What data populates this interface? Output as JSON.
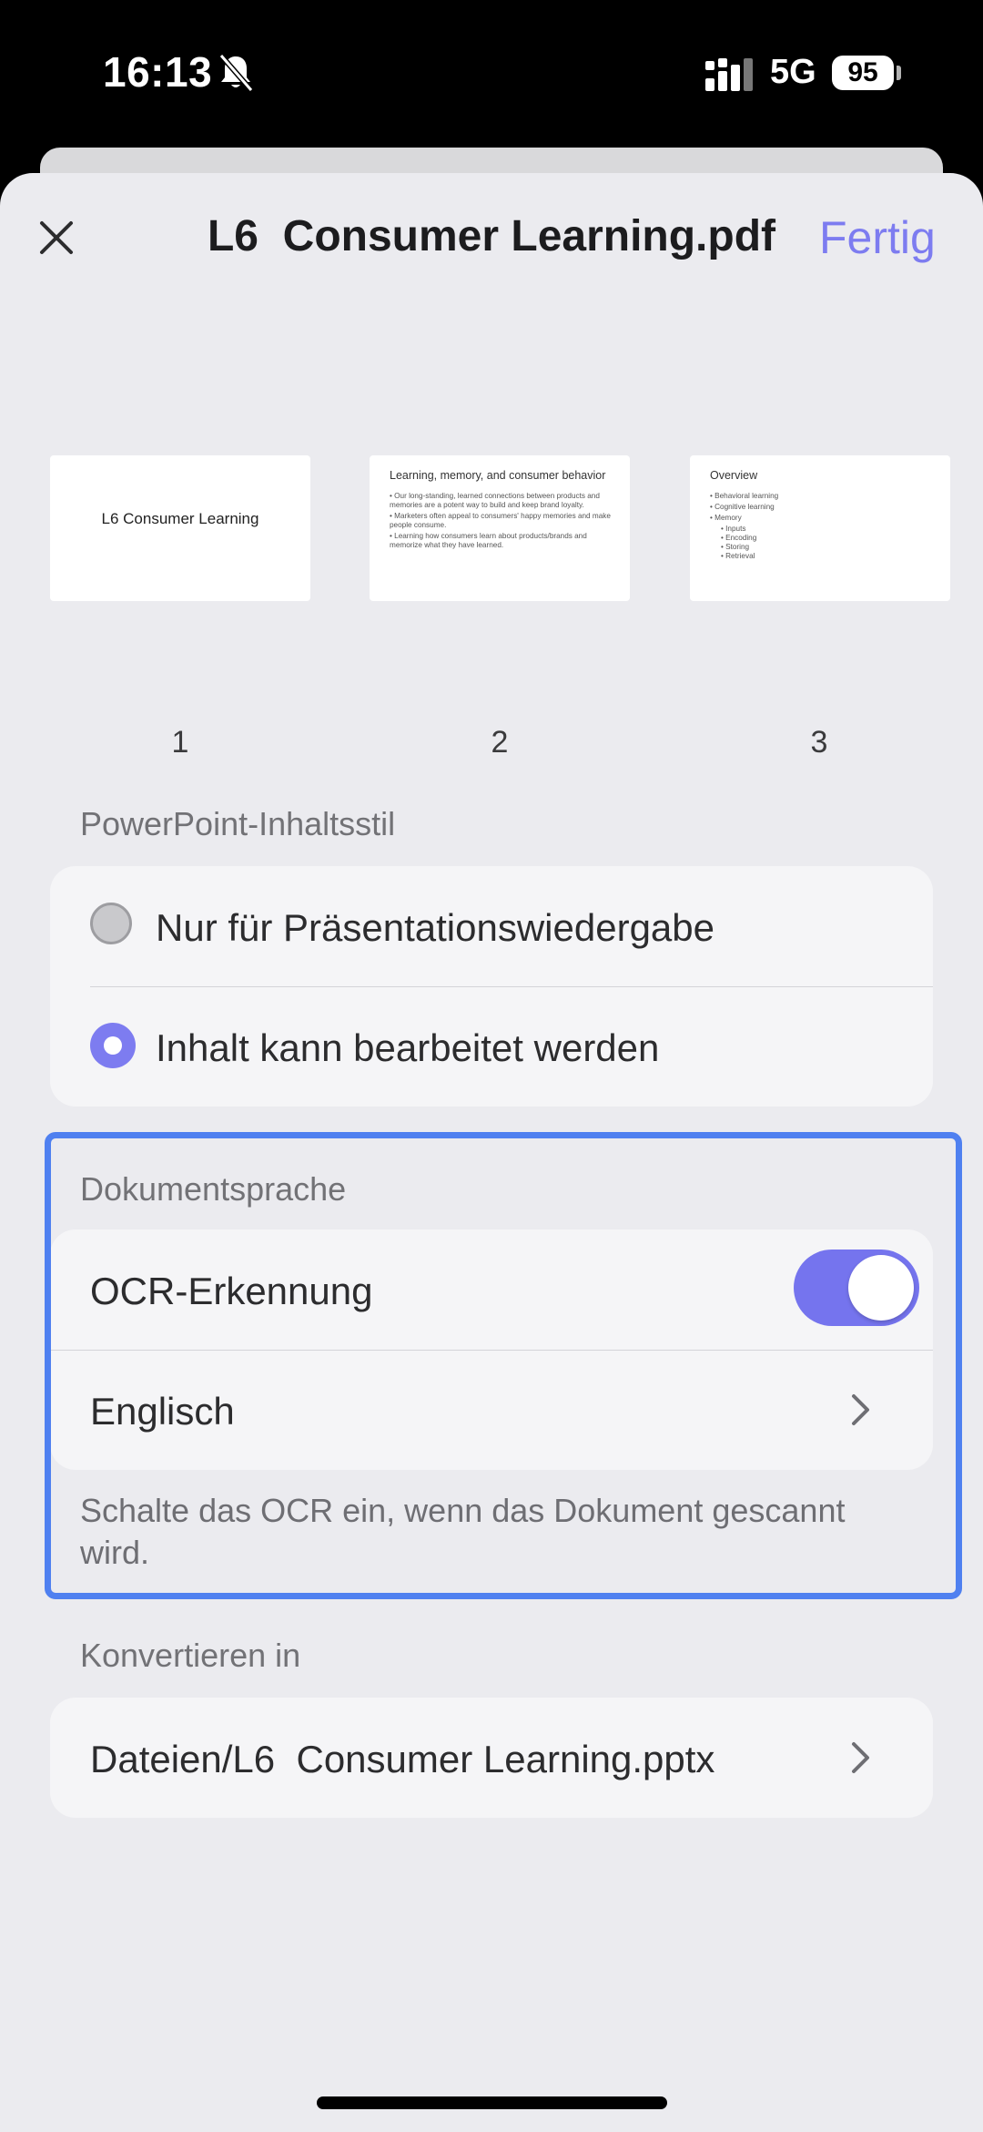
{
  "status_bar": {
    "time": "16:13",
    "network": "5G",
    "battery": "95",
    "icons": [
      "bell-slash-icon",
      "signal-icon",
      "battery-icon"
    ]
  },
  "header": {
    "title": "L6  Consumer Learning.pdf",
    "done_label": "Fertig",
    "close_icon": "close-icon"
  },
  "thumbnails": [
    {
      "page": "1",
      "slide_title": "L6 Consumer Learning"
    },
    {
      "page": "2",
      "heading": "Learning, memory, and consumer behavior",
      "bullets": [
        "• Our long-standing, learned connections between products and memories are a potent way to build and keep brand loyalty.",
        "• Marketers often appeal to consumers' happy memories and make people consume.",
        "• Learning how consumers learn about products/brands and memorize what they have learned."
      ]
    },
    {
      "page": "3",
      "heading": "Overview",
      "bullets": [
        "• Behavioral learning",
        "• Cognitive learning",
        "• Memory"
      ],
      "sub_bullets": [
        "• Inputs",
        "• Encoding",
        "• Storing",
        "• Retrieval"
      ]
    }
  ],
  "content_style": {
    "label": "PowerPoint-Inhaltsstil",
    "options": [
      {
        "label": "Nur für Präsentationswiedergabe",
        "selected": false
      },
      {
        "label": "Inhalt kann bearbeitet werden",
        "selected": true
      }
    ]
  },
  "document_language": {
    "label": "Dokumentsprache",
    "ocr_label": "OCR-Erkennung",
    "ocr_enabled": true,
    "language": "Englisch",
    "footnote": "Schalte das OCR ein, wenn das Dokument gescannt wird."
  },
  "convert": {
    "label": "Konvertieren in",
    "path": "Dateien/L6  Consumer Learning.pptx"
  },
  "colors": {
    "accent": "#7d7cf0",
    "highlight_border": "#4f80f0",
    "sheet_background": "#ebebef",
    "card_background": "#f5f5f7"
  }
}
